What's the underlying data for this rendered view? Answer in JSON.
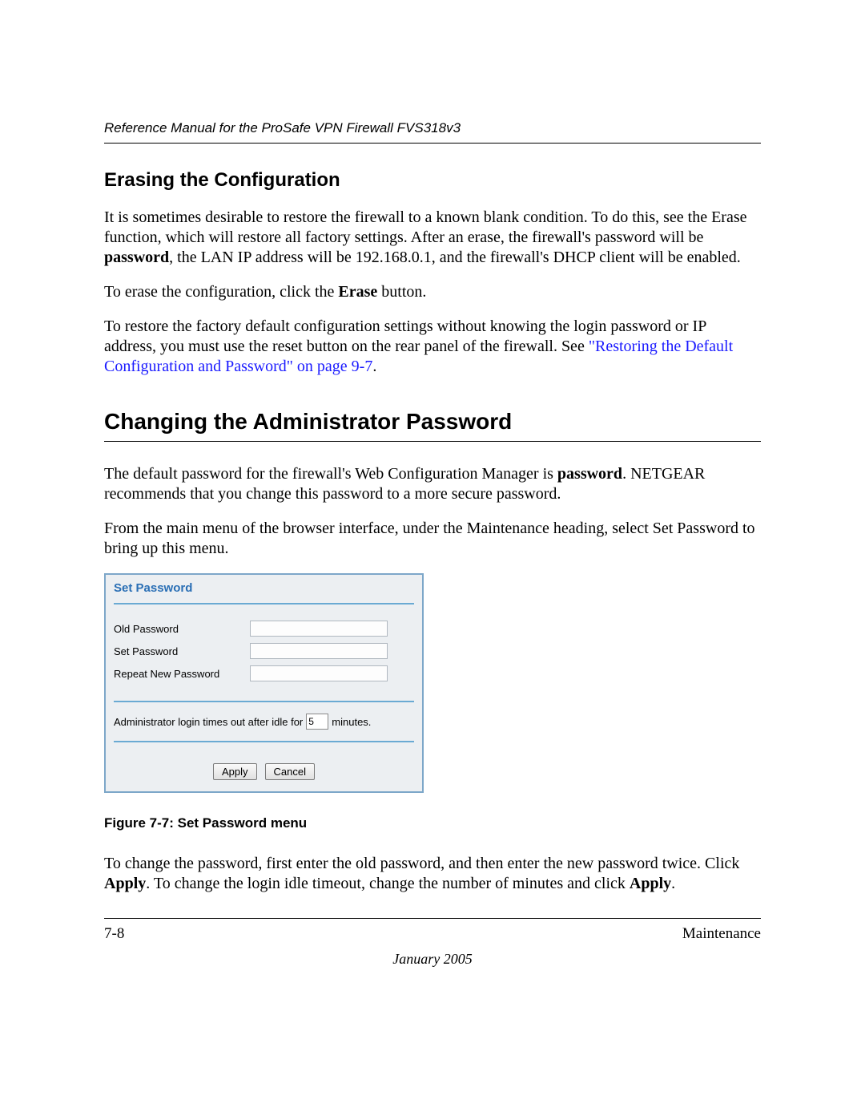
{
  "header": {
    "running_title": "Reference Manual for the ProSafe VPN Firewall FVS318v3"
  },
  "section1": {
    "title": "Erasing the Configuration",
    "p1_a": "It is sometimes desirable to restore the firewall to a known blank condition. To do this, see the Erase function, which will restore all factory settings. After an erase, the firewall's password will be ",
    "p1_b": "password",
    "p1_c": ", the LAN IP address will be 192.168.0.1, and the firewall's DHCP client will be enabled.",
    "p2_a": "To erase the configuration, click the ",
    "p2_b": "Erase",
    "p2_c": " button.",
    "p3_a": "To restore the factory default configuration settings without knowing the login password or IP address, you must use the reset button on the rear panel of the firewall. See ",
    "p3_link": "\"Restoring the Default Configuration and Password\" on page 9-7",
    "p3_c": "."
  },
  "section2": {
    "title": "Changing the Administrator Password",
    "p1_a": "The default password for the firewall's Web Configuration Manager is ",
    "p1_b": "password",
    "p1_c": ". NETGEAR recommends that you change this password to a more secure password.",
    "p2": "From the main menu of the browser interface, under the Maintenance heading, select Set Password to bring up this menu."
  },
  "figure": {
    "panel_title": "Set Password",
    "old_pw": "Old Password",
    "set_pw": "Set Password",
    "repeat_pw": "Repeat New Password",
    "idle_a": "Administrator login times out after idle for",
    "idle_value": "5",
    "idle_b": "minutes.",
    "apply": "Apply",
    "cancel": "Cancel",
    "caption": "Figure 7-7:  Set Password menu"
  },
  "after_figure": {
    "p_a": "To change the password, first enter the old password, and then enter the new password twice. Click ",
    "p_b": "Apply",
    "p_c": ". To change the login idle timeout, change the number of minutes and click ",
    "p_d": "Apply",
    "p_e": "."
  },
  "footer": {
    "page": "7-8",
    "section": "Maintenance",
    "date": "January 2005"
  }
}
